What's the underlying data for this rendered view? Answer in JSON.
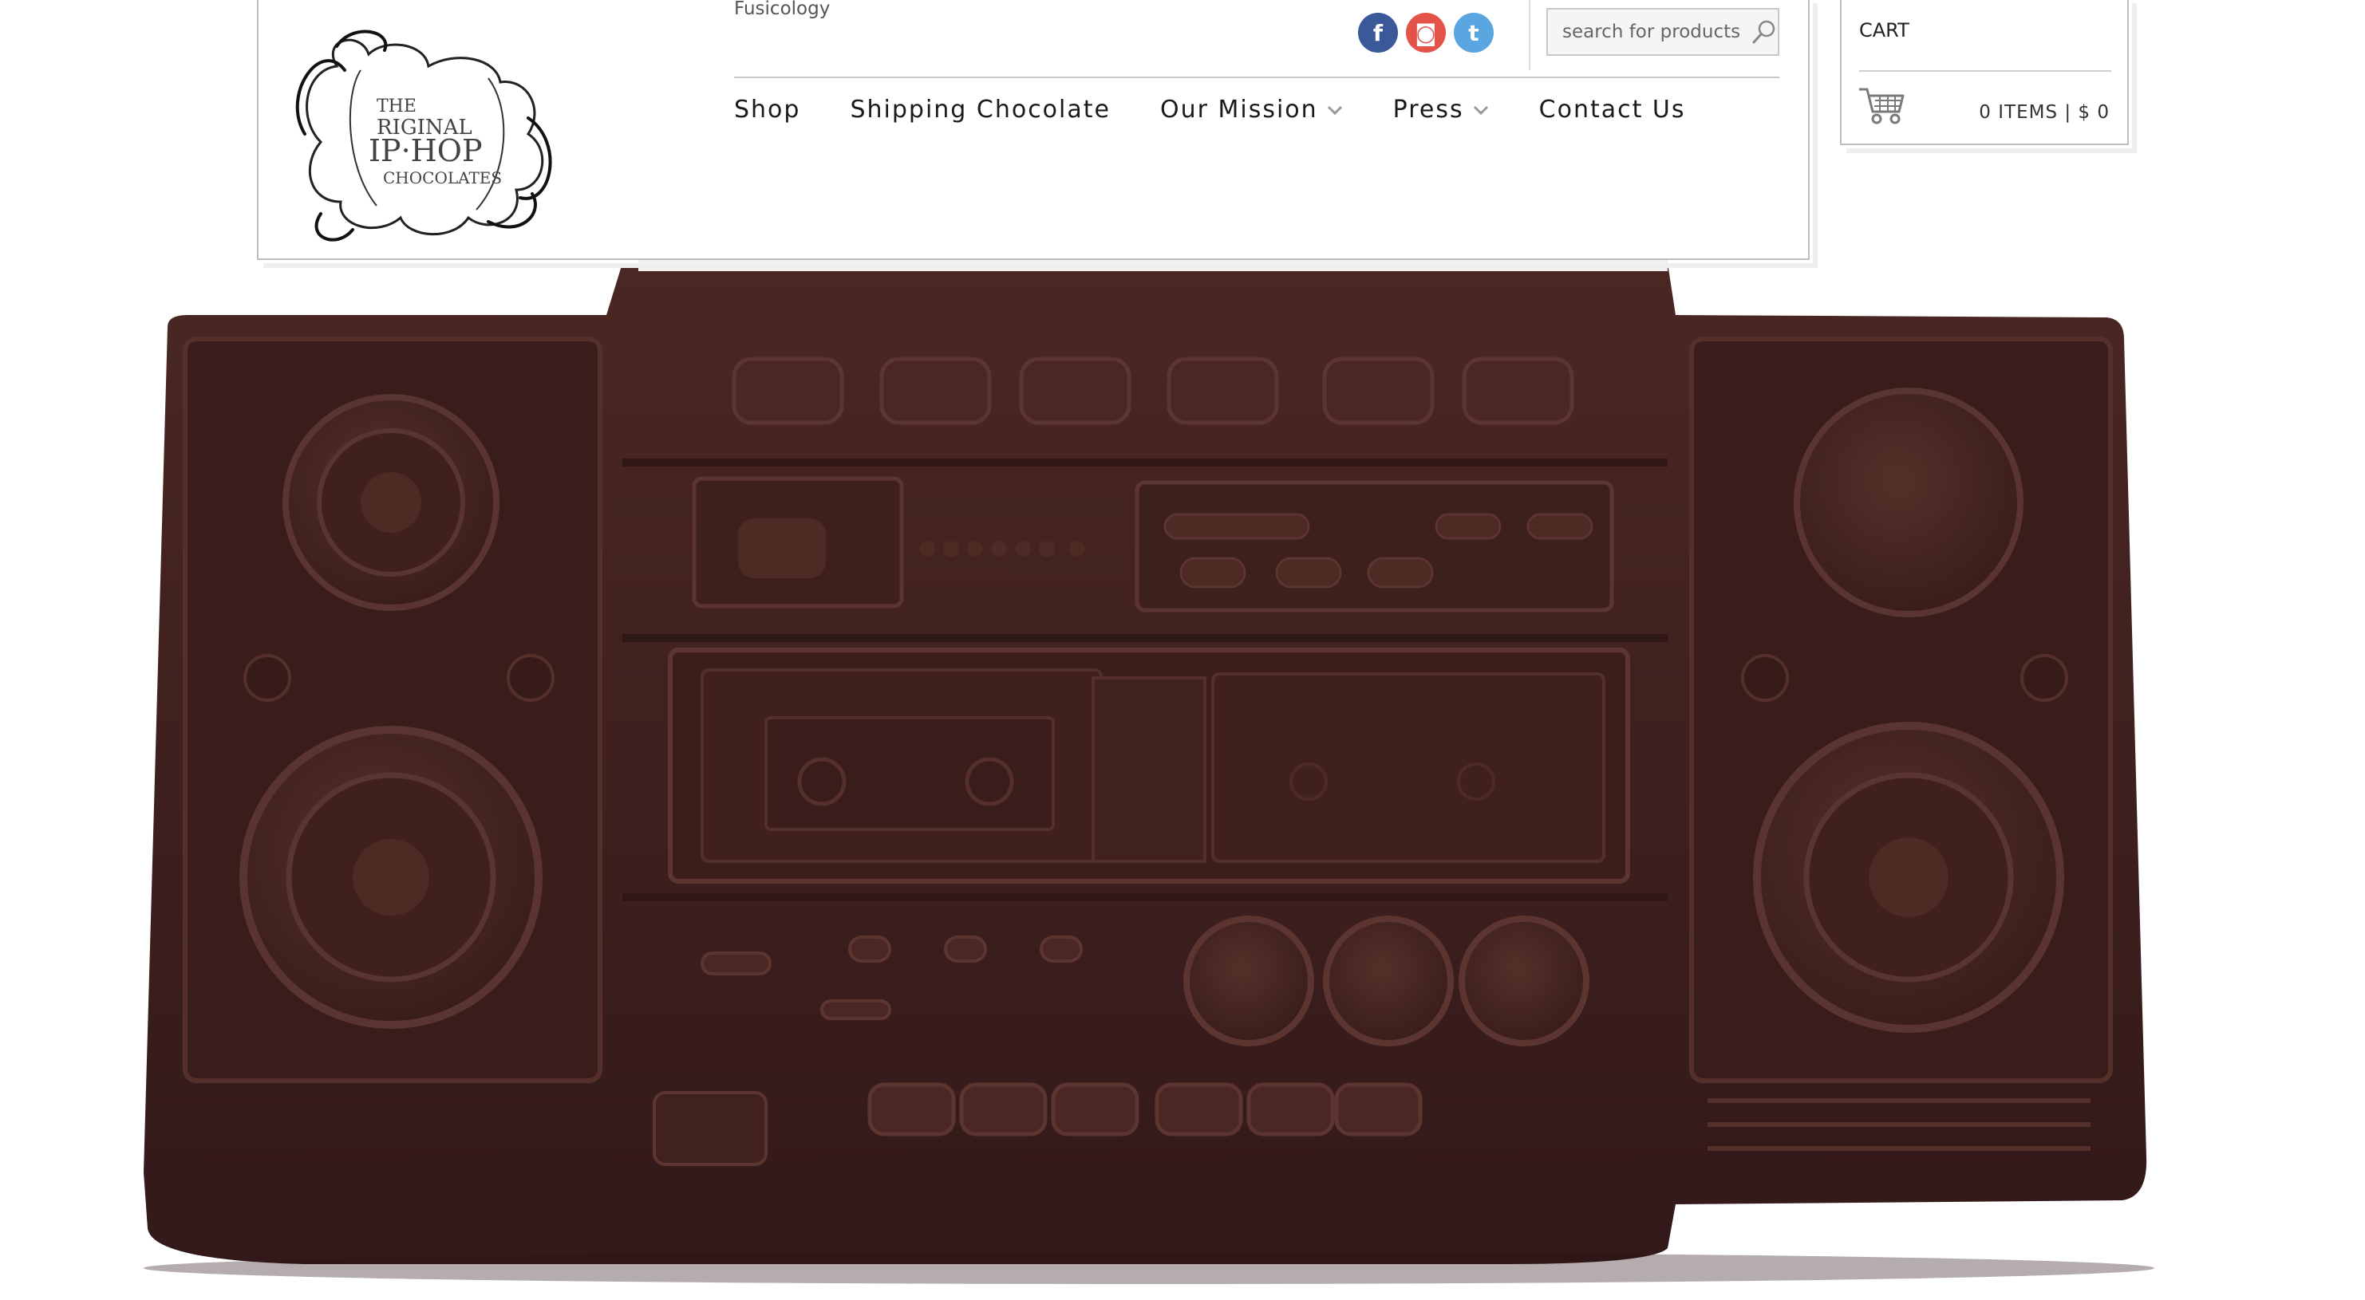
{
  "header": {
    "tagline": "Fusicology",
    "logo": {
      "alt": "The Original Hip-Hop Chocolates",
      "lines": [
        "THE",
        "RIGINAL",
        "IP·HOP",
        "CHOCOLATES"
      ]
    },
    "social": [
      {
        "name": "facebook",
        "icon": "facebook-icon",
        "glyph": "f",
        "color": "#3b5998"
      },
      {
        "name": "instagram",
        "icon": "instagram-icon",
        "glyph": "◙",
        "color": "#e4534a"
      },
      {
        "name": "twitter",
        "icon": "twitter-icon",
        "glyph": "t",
        "color": "#5aa6e0"
      }
    ],
    "search": {
      "placeholder": "search for products",
      "value": ""
    },
    "nav": [
      {
        "label": "Shop",
        "dropdown": false
      },
      {
        "label": "Shipping Chocolate",
        "dropdown": false
      },
      {
        "label": "Our Mission",
        "dropdown": true
      },
      {
        "label": "Press",
        "dropdown": true
      },
      {
        "label": "Contact Us",
        "dropdown": false
      }
    ]
  },
  "cart": {
    "title": "CART",
    "summary": "0 ITEMS | $ 0",
    "icon": "shopping-cart-icon"
  },
  "hero": {
    "subject": "boombox-chocolate-image",
    "colors": {
      "chocolate": "#3e201c",
      "chocolate_light": "#4d2a25",
      "chocolate_dark": "#2c1512"
    }
  }
}
